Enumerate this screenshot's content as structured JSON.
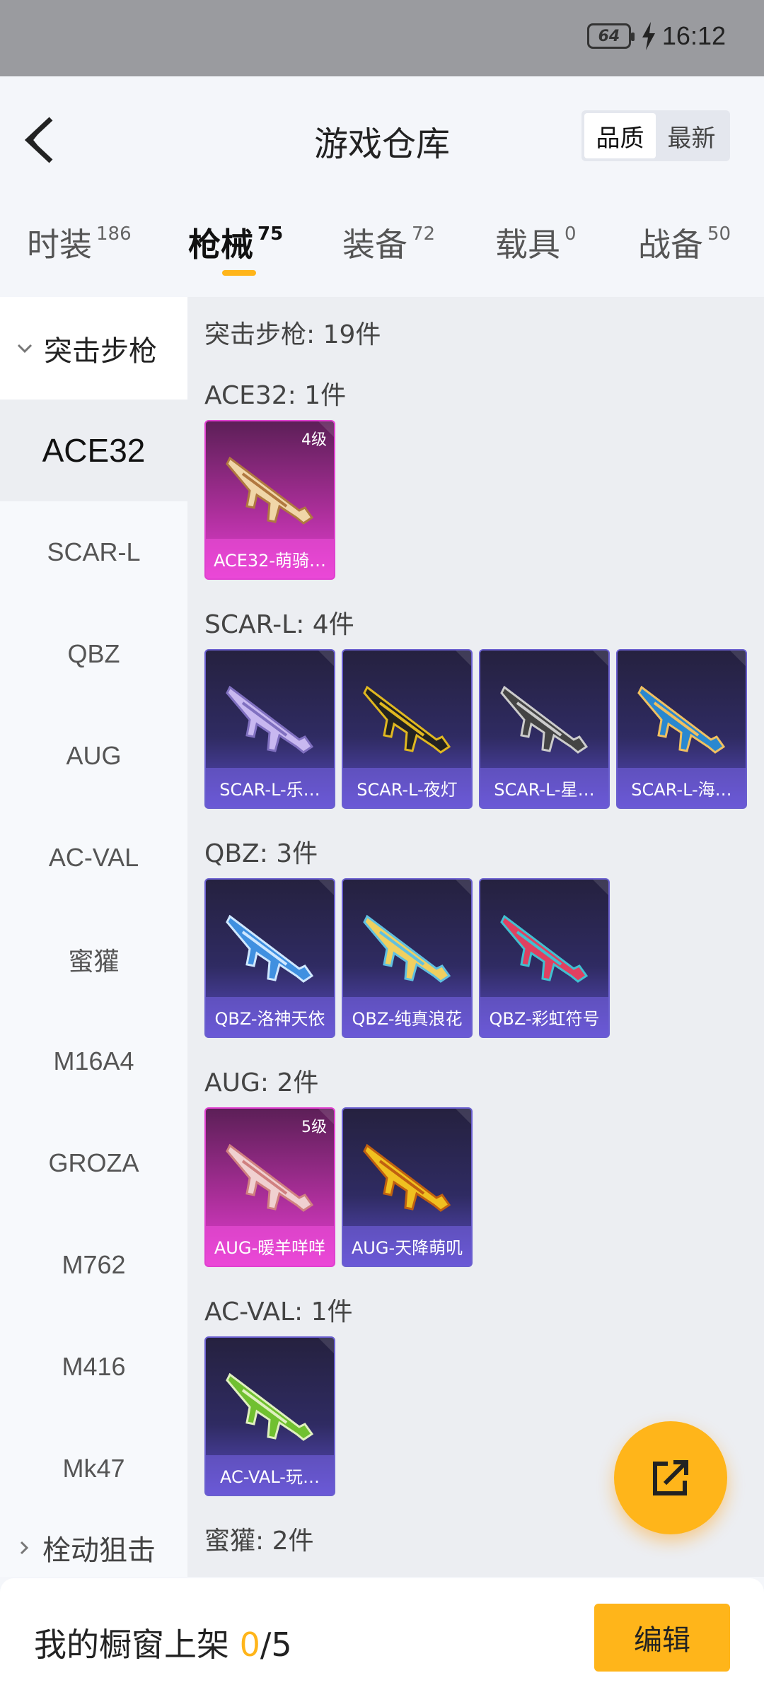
{
  "status": {
    "battery": "64",
    "time": "16:12"
  },
  "header": {
    "title": "游戏仓库",
    "sort_options": [
      "品质",
      "最新"
    ]
  },
  "tabs": [
    {
      "label": "时装",
      "count": "186"
    },
    {
      "label": "枪械",
      "count": "75"
    },
    {
      "label": "装备",
      "count": "72"
    },
    {
      "label": "载具",
      "count": "0"
    },
    {
      "label": "战备",
      "count": "50"
    }
  ],
  "sidebar": {
    "category": "突击步枪",
    "items": [
      "ACE32",
      "SCAR-L",
      "QBZ",
      "AUG",
      "AC-VAL",
      "蜜獾",
      "M16A4",
      "GROZA",
      "M762",
      "M416",
      "Mk47"
    ],
    "next_category": "栓动狙击"
  },
  "main": {
    "summary": "突击步枪: 19件",
    "groups": [
      {
        "label": "ACE32: 1件",
        "cards": [
          {
            "name": "ACE32-萌骑…",
            "level": "4级",
            "style": "pink"
          }
        ]
      },
      {
        "label": "SCAR-L: 4件",
        "cards": [
          {
            "name": "SCAR-L-乐…",
            "style": "purple"
          },
          {
            "name": "SCAR-L-夜灯",
            "style": "purple"
          },
          {
            "name": "SCAR-L-星…",
            "style": "purple"
          },
          {
            "name": "SCAR-L-海…",
            "style": "purple"
          }
        ]
      },
      {
        "label": "QBZ: 3件",
        "cards": [
          {
            "name": "QBZ-洛神天依",
            "style": "purple"
          },
          {
            "name": "QBZ-纯真浪花",
            "style": "purple"
          },
          {
            "name": "QBZ-彩虹符号",
            "style": "purple"
          }
        ]
      },
      {
        "label": "AUG: 2件",
        "cards": [
          {
            "name": "AUG-暖羊咩咩",
            "level": "5级",
            "style": "pink"
          },
          {
            "name": "AUG-天降萌叽",
            "style": "purple"
          }
        ]
      },
      {
        "label": "AC-VAL: 1件",
        "cards": [
          {
            "name": "AC-VAL-玩…",
            "style": "purple"
          }
        ]
      },
      {
        "label": "蜜獾: 2件",
        "cards": []
      }
    ]
  },
  "bottom": {
    "label": "我的橱窗上架",
    "current": "0",
    "total": "/5",
    "edit": "编辑"
  },
  "colors": {
    "accent": "#ffb51a",
    "purple_card": "#2f2b62",
    "pink_card": "#a82e97"
  }
}
